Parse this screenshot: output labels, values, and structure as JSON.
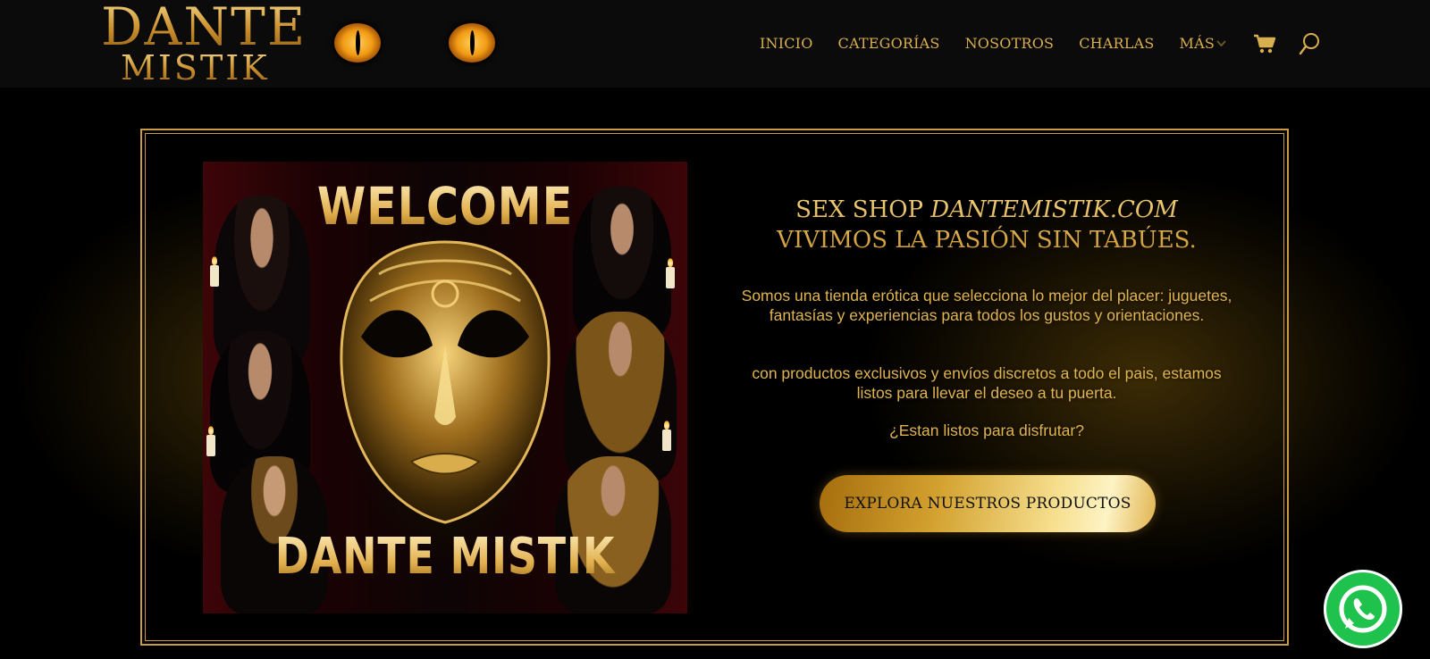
{
  "brand": {
    "logo_line1": "DANTE",
    "logo_line2": "MISTIK",
    "accent_color": "#d8ae4f"
  },
  "nav": {
    "items": [
      {
        "label": "INICIO"
      },
      {
        "label": "CATEGORÍAS"
      },
      {
        "label": "NOSOTROS"
      },
      {
        "label": "CHARLAS"
      },
      {
        "label": "MÁS"
      }
    ],
    "more_icon": "chevron-down-icon",
    "cart_icon": "shopping-cart-icon",
    "search_icon": "search-icon"
  },
  "hero": {
    "poster": {
      "welcome_text": "WELCOME",
      "brand_text": "DANTE MISTIK"
    },
    "headline_line1_prefix": "SEX SHOP ",
    "headline_line1_italic": "DANTEMISTIK.COM",
    "headline_line2": "VIVIMOS LA PASIÓN SIN TABÚES.",
    "paragraph_1": "Somos una tienda erótica que selecciona lo mejor del placer: juguetes, fantasías y experiencias para todos los gustos y orientaciones.",
    "paragraph_2": "con productos exclusivos y envíos discretos a todo el pais, estamos listos para llevar el deseo a tu puerta.",
    "paragraph_3": "¿Estan listos para disfrutar?",
    "cta_label": "EXPLORA NUESTROS PRODUCTOS"
  },
  "whatsapp": {
    "icon": "whatsapp-icon",
    "color": "#1fc24c"
  }
}
